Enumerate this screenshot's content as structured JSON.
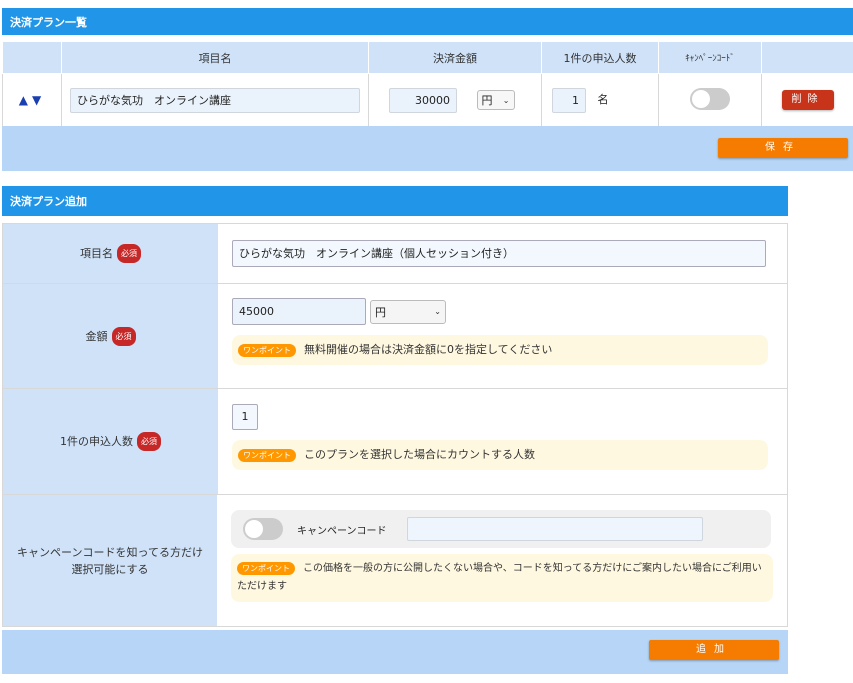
{
  "plan_list": {
    "title": "決済プラン一覧",
    "columns": [
      "",
      "項目名",
      "決済金額",
      "1件の申込人数",
      "ｷｬﾝﾍﾟｰﾝｺｰﾄﾞ",
      ""
    ],
    "rows": [
      {
        "arrows": "▲▼",
        "name": "ひらがな気功　オンライン講座",
        "amount": "30000",
        "currency": "円",
        "count": "1",
        "count_unit": "名",
        "campaign_on": false,
        "delete_label": "削除"
      }
    ],
    "save_label": "保存"
  },
  "add_form": {
    "title": "決済プラン追加",
    "required_badge": "必須",
    "tip_badge": "ワンポイント",
    "name": {
      "label": "項目名",
      "value": "ひらがな気功　オンライン講座（個人セッション付き）"
    },
    "amount": {
      "label": "金額",
      "value": "45000",
      "currency": "円",
      "tip": "無料開催の場合は決済金額に0を指定してください"
    },
    "count": {
      "label": "1件の申込人数",
      "value": "1",
      "tip": "このプランを選択した場合にカウントする人数"
    },
    "campaign": {
      "label": "キャンペーンコードを知ってる方だけ選択可能にする",
      "toggle_label": "キャンペーンコード",
      "code_value": "",
      "toggle_on": false,
      "tip": "この価格を一般の方に公開したくない場合や、コードを知ってる方だけにご案内したい場合にご利用いただけます"
    },
    "add_label": "追加"
  },
  "colors": {
    "header": "#2196e8",
    "label_bg": "#cfe2f8",
    "bar": "#b7d6f7",
    "accent": "#f57c00",
    "delete": "#c8341a"
  }
}
